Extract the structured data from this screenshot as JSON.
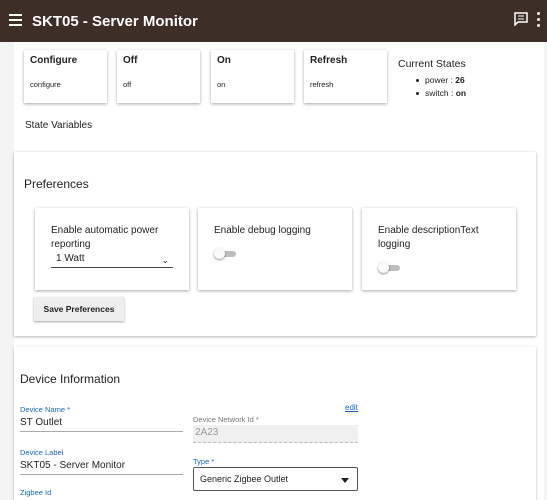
{
  "header": {
    "title": "SKT05 - Server Monitor",
    "menu_icon": "hamburger-menu-icon",
    "chat_icon": "chat-icon",
    "more_icon": "more-vert-icon",
    "bar_color": "#3e2e28"
  },
  "commands": [
    {
      "title": "Configure",
      "sub": "configure"
    },
    {
      "title": "Off",
      "sub": "off"
    },
    {
      "title": "On",
      "sub": "on"
    },
    {
      "title": "Refresh",
      "sub": "refresh"
    }
  ],
  "current_states": {
    "title": "Current States",
    "items": [
      {
        "key": "power",
        "value": "26"
      },
      {
        "key": "switch",
        "value": "on"
      }
    ]
  },
  "state_variables_label": "State Variables",
  "preferences": {
    "title": "Preferences",
    "power_reporting": {
      "label": "Enable automatic power reporting",
      "selected": "1 Watt"
    },
    "debug_logging": {
      "label": "Enable debug logging",
      "enabled": false
    },
    "description_logging": {
      "label": "Enable descriptionText logging",
      "enabled": false
    },
    "save_label": "Save Preferences"
  },
  "device_info": {
    "title": "Device Information",
    "edit_label": "edit",
    "device_name": {
      "label": "Device Name *",
      "value": "ST Outlet"
    },
    "network_id": {
      "label": "Device Network Id *",
      "value": "2A23"
    },
    "device_label": {
      "label": "Device Label",
      "value": "SKT05 - Server Monitor"
    },
    "type": {
      "label": "Type *",
      "value": "Generic Zigbee Outlet"
    },
    "zigbee_id": {
      "label": "Zigbee Id"
    }
  }
}
